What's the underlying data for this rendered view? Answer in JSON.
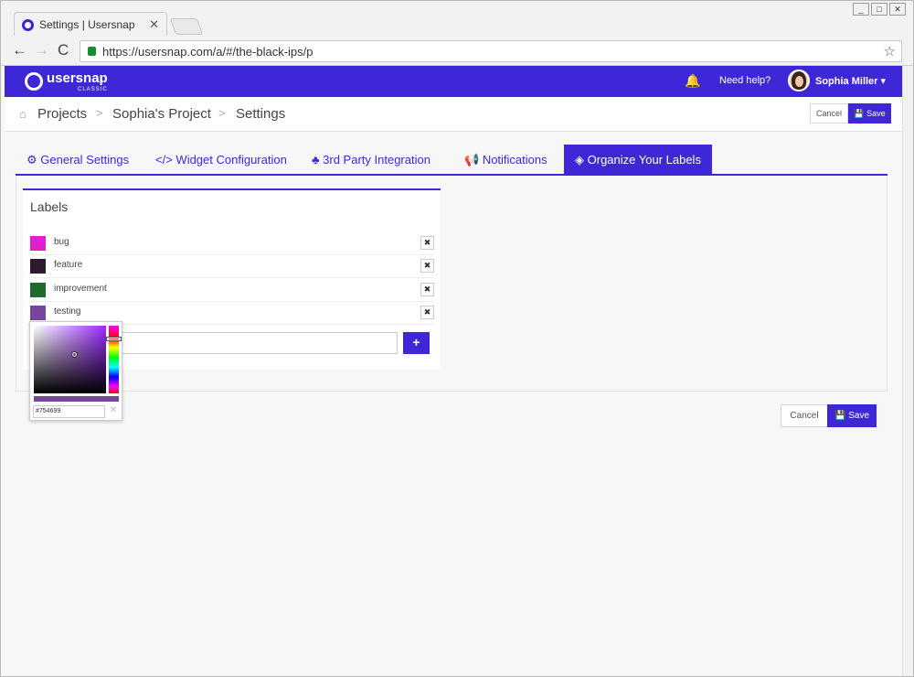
{
  "browser": {
    "tab_title": "Settings | Usersnap",
    "tab_close": "✕",
    "url": "https://usersnap.com/a/#/the-black-ips/p",
    "back": "←",
    "forward": "→",
    "reload": "C",
    "star": "☆"
  },
  "header": {
    "logo": "usersnap",
    "logo_sub": "CLASSIC",
    "help": "Need help?",
    "user": "Sophia Miller ▾"
  },
  "breadcrumb": {
    "items": [
      "Projects",
      "Sophia's Project",
      "Settings"
    ],
    "separator": ">"
  },
  "actions": {
    "cancel": "Cancel",
    "save": "Save"
  },
  "tabs": [
    {
      "label": "General Settings",
      "icon": "⚙"
    },
    {
      "label": "Widget Configuration",
      "icon": "</>"
    },
    {
      "label": "3rd Party Integration",
      "icon": "♣"
    },
    {
      "label": "Notifications",
      "icon": "📢"
    },
    {
      "label": "Organize Your Labels",
      "icon": "◈"
    }
  ],
  "labels_card": {
    "title": "Labels",
    "labels": [
      {
        "name": "bug",
        "color": "#e01fd1"
      },
      {
        "name": "feature",
        "color": "#2e1a2e"
      },
      {
        "name": "improvement",
        "color": "#1e6b2d"
      },
      {
        "name": "testing",
        "color": "#754699"
      }
    ],
    "add": "+"
  },
  "color_picker": {
    "hex": "#754699",
    "clear": "✕",
    "current_color": "#754699"
  },
  "colors": {
    "accent": "#3d27d6"
  }
}
